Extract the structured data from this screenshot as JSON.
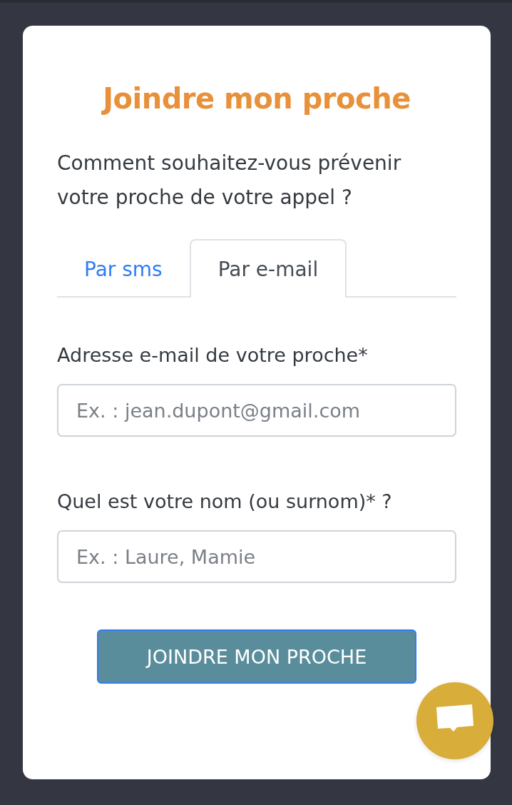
{
  "title": "Joindre mon proche",
  "intro": "Comment souhaitez-vous prévenir votre proche de votre appel ?",
  "tabs": [
    {
      "label": "Par sms",
      "selected": false
    },
    {
      "label": "Par e-mail",
      "selected": true
    }
  ],
  "fields": [
    {
      "label": "Adresse e-mail de votre proche*",
      "placeholder": "Ex. : jean.dupont@gmail.com"
    },
    {
      "label": "Quel est votre nom (ou surnom)* ?",
      "placeholder": "Ex. : Laure, Mamie"
    }
  ],
  "submit_button": {
    "label": "JOINDRE MON PROCHE"
  }
}
